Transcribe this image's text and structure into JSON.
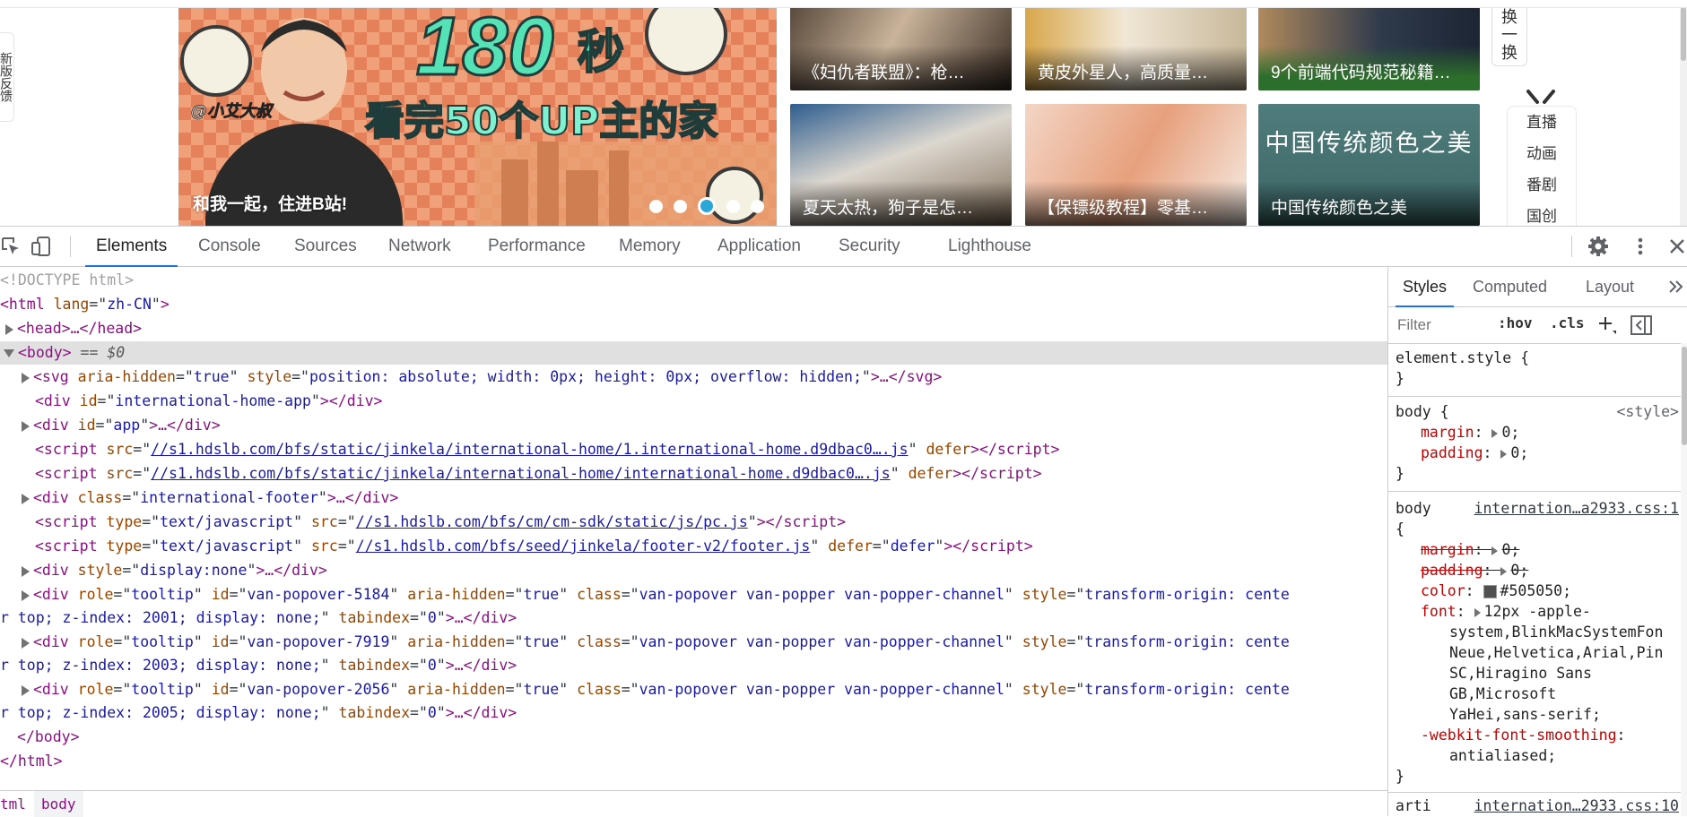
{
  "page": {
    "side_feedback": "新版反馈",
    "banner": {
      "headline_number": "180",
      "headline_unit": "秒",
      "subtitle": "看完50个UP主的家",
      "handle": "@小艾大叔",
      "caption": "和我一起，住进B站!",
      "slide_count": 5,
      "active_slide": 3
    },
    "cards": [
      {
        "title": "《妇仇者联盟》：枪…"
      },
      {
        "title": "黄皮外星人，高质量…"
      },
      {
        "title": "9个前端代码规范秘籍…"
      },
      {
        "title": "夏天太热，狗子是怎…"
      },
      {
        "title": "【保镖级教程】零基…"
      },
      {
        "title": "中国传统颜色之美",
        "overlay_text": "中国传统颜色之美"
      }
    ],
    "swap_button": [
      "换",
      "一",
      "换"
    ],
    "channels": [
      "直播",
      "动画",
      "番剧",
      "国创"
    ]
  },
  "devtools": {
    "tabs": [
      "Elements",
      "Console",
      "Sources",
      "Network",
      "Performance",
      "Memory",
      "Application",
      "Security",
      "Lighthouse"
    ],
    "active_tab": "Elements",
    "dom": {
      "doctype": "<!DOCTYPE html>",
      "html_open": {
        "tag": "<html",
        "attr": "lang",
        "val": "zh-CN",
        "close": ">"
      },
      "head": "<head>…</head>",
      "body_open": "<body>",
      "body_marker": " == $0",
      "svg": {
        "attr1": "aria-hidden",
        "val1": "true",
        "attr2": "style",
        "val2": "position: absolute; width: 0px; height: 0px; overflow: hidden;",
        "tail": "…</svg>"
      },
      "div_intl": {
        "attr": "id",
        "val": "international-home-app"
      },
      "div_app": {
        "attr": "id",
        "val": "app"
      },
      "script1": {
        "src": "//s1.hdslb.com/bfs/static/jinkela/international-home/1.international-home.d9dbac0….js",
        "extra": "defer"
      },
      "script2": {
        "src": "//s1.hdslb.com/bfs/static/jinkela/international-home/international-home.d9dbac0….js",
        "extra": "defer"
      },
      "div_footer": {
        "attr": "class",
        "val": "international-footer"
      },
      "script3": {
        "type": "text/javascript",
        "src": "//s1.hdslb.com/bfs/cm/cm-sdk/static/js/pc.js"
      },
      "script4": {
        "type": "text/javascript",
        "src": "//s1.hdslb.com/bfs/seed/jinkela/footer-v2/footer.js",
        "defer": "defer"
      },
      "div_hidden": {
        "attr": "style",
        "val": "display:none"
      },
      "popovers": [
        {
          "id": "van-popover-5184",
          "z": "2001"
        },
        {
          "id": "van-popover-7919",
          "z": "2003"
        },
        {
          "id": "van-popover-2056",
          "z": "2005"
        }
      ],
      "popover_class": "van-popover van-popper van-popper-channel",
      "popover_style_head": "transform-origin: cente",
      "popover_style_tail_prefix": "r top; z-index: ",
      "popover_style_tail_suffix": "; display: none;",
      "body_close": "</body>",
      "html_close": "</html>"
    },
    "breadcrumbs": [
      "tml",
      "body"
    ],
    "styles": {
      "tabs": [
        "Styles",
        "Computed",
        "Layout"
      ],
      "filter_placeholder": "Filter",
      "hov": ":hov",
      "cls": ".cls",
      "rules": {
        "element_style": "element.style {",
        "close": "}",
        "body1_selector": "body {",
        "body1_source": "<style>",
        "margin": "margin",
        "padding": "padding",
        "zero": "0;",
        "body2_selector": "body",
        "body2_source": "internation…a2933.css:1",
        "open_brace": "{",
        "color_prop": "color",
        "color_val": "#505050;",
        "font_prop": "font",
        "font_val_lines": [
          "12px -apple-",
          "system,BlinkMacSystemFon",
          "Neue,Helvetica,Arial,Pin",
          "SC,Hiragino Sans",
          "GB,Microsoft",
          "YaHei,sans-serif;"
        ],
        "smoothing_prop": "-webkit-font-smoothing",
        "smoothing_val": "antialiased;",
        "next_selector": "arti",
        "next_source": "internation…2933.css:10"
      }
    }
  }
}
